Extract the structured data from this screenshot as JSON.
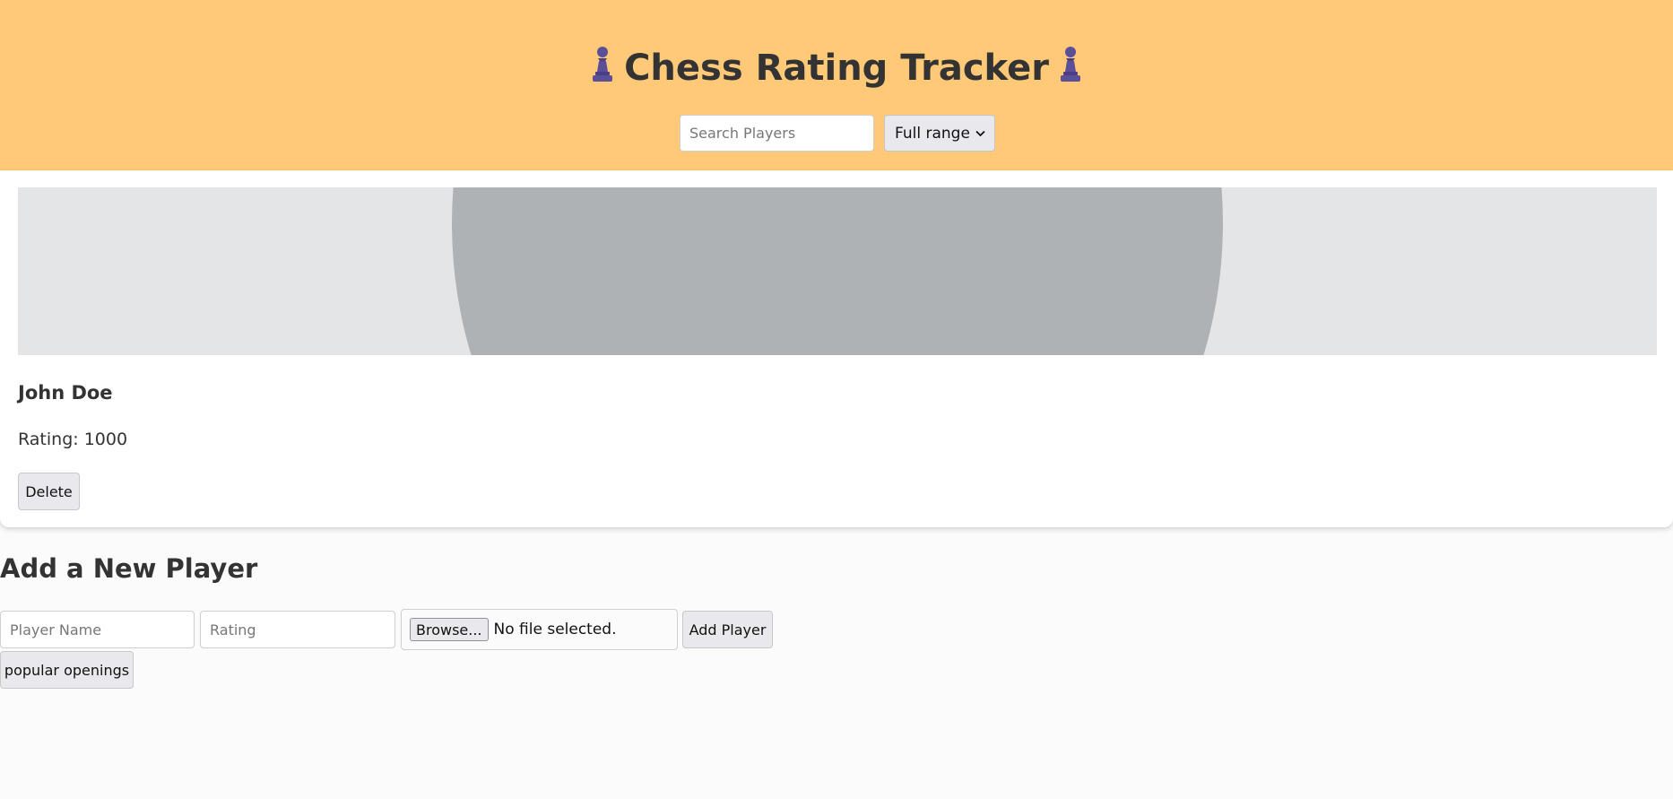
{
  "header": {
    "title": "Chess Rating Tracker",
    "icon": "pawn-icon",
    "search_placeholder": "Search Players",
    "range_selected": "Full range"
  },
  "players": [
    {
      "name": "John Doe",
      "rating_text": "Rating: 1000",
      "delete_label": "Delete"
    }
  ],
  "add_form": {
    "heading": "Add a New Player",
    "name_placeholder": "Player Name",
    "rating_placeholder": "Rating",
    "browse_label": "Browse...",
    "file_status": "No file selected.",
    "add_label": "Add Player",
    "openings_label": "popular openings"
  },
  "colors": {
    "header_bg": "#ffc978",
    "page_bg": "#fbfbfb",
    "pawn": "#5b4f97"
  }
}
